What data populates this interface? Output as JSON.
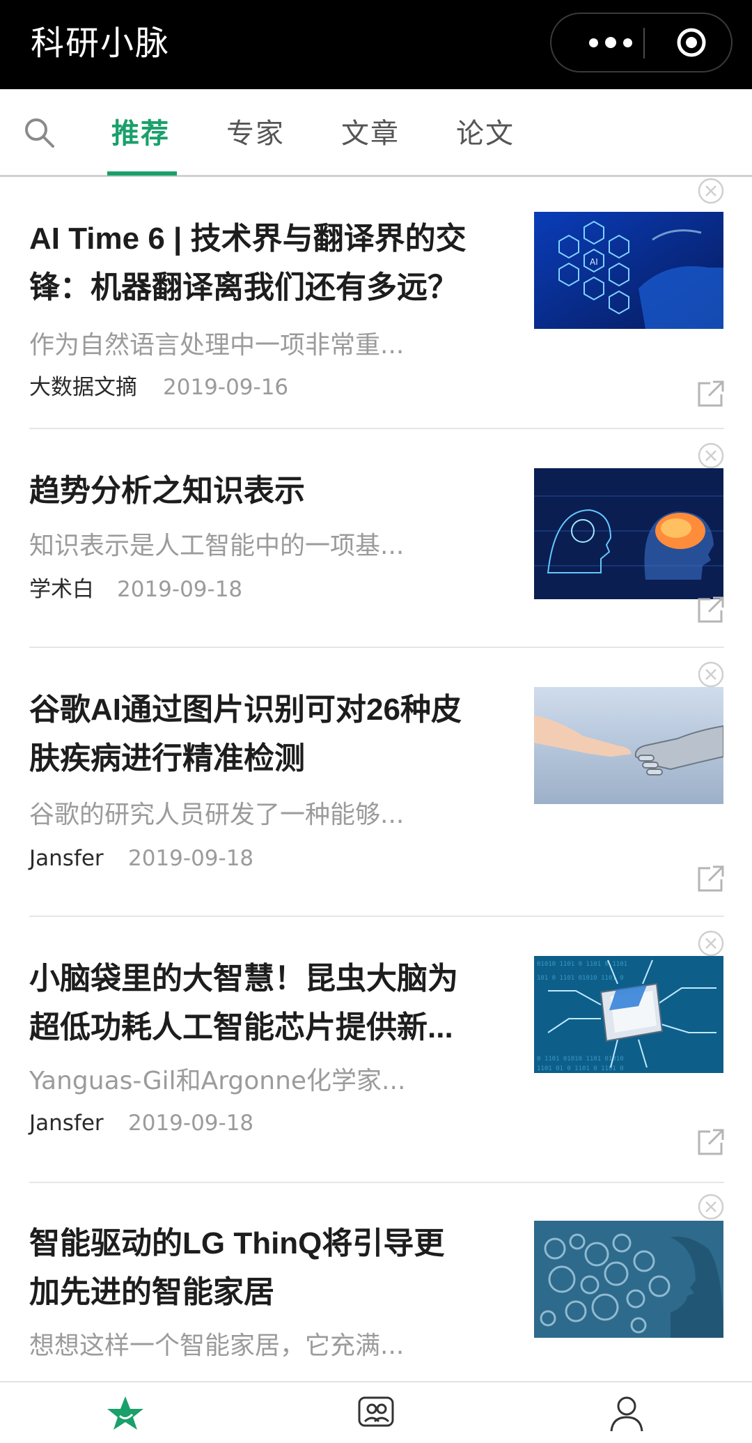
{
  "app": {
    "title": "科研小脉",
    "menu_icon": "more-dots-icon",
    "close_icon": "target-circle-icon"
  },
  "tabs": {
    "search_icon": "search-icon",
    "items": [
      {
        "label": "推荐",
        "active": true
      },
      {
        "label": "专家",
        "active": false
      },
      {
        "label": "文章",
        "active": false
      },
      {
        "label": "论文",
        "active": false
      }
    ]
  },
  "colors": {
    "accent": "#1aa06a",
    "topbar": "#000000",
    "summary_text": "#9b9b9b"
  },
  "articles": [
    {
      "title": "AI Time 6 | 技术界与翻译界的交锋：机器翻译离我们还有多远？",
      "title_lines": [
        "AI Time 6 | 技术界与翻译界的交",
        "锋：机器翻译离我们还有多远？"
      ],
      "summary": "作为自然语言处理中一项非常重...",
      "source": "大数据文摘",
      "date": "2019-09-16",
      "thumb": "ai-hexagon-tech"
    },
    {
      "title": "趋势分析之知识表示",
      "title_lines": [
        "趋势分析之知识表示"
      ],
      "summary": "知识表示是人工智能中的一项基...",
      "source": "学术白",
      "date": "2019-09-18",
      "thumb": "ai-brain-heads"
    },
    {
      "title": "谷歌AI通过图片识别可对26种皮肤疾病进行精准检测",
      "title_lines": [
        "谷歌AI通过图片识别可对26种皮",
        "肤疾病进行精准检测"
      ],
      "summary": "谷歌的研究人员研发了一种能够...",
      "source": "Jansfer",
      "date": "2019-09-18",
      "thumb": "robot-human-hands"
    },
    {
      "title": "小脑袋里的大智慧！昆虫大脑为超低功耗人工智能芯片提供新...",
      "title_lines": [
        "小脑袋里的大智慧！昆虫大脑为",
        "超低功耗人工智能芯片提供新..."
      ],
      "summary": "Yanguas-Gil和Argonne化学家...",
      "source": "Jansfer",
      "date": "2019-09-18",
      "thumb": "circuit-chip"
    },
    {
      "title": "智能驱动的LG ThinQ将引导更加先进的智能家居",
      "title_lines": [
        "智能驱动的LG ThinQ将引导更",
        "加先进的智能家居"
      ],
      "summary": "想想这样一个智能家居，它充满...",
      "source": "",
      "date": "",
      "thumb": "gear-head"
    }
  ],
  "bottom_nav": [
    {
      "icon": "star-icon",
      "active": true
    },
    {
      "icon": "group-icon",
      "active": false
    },
    {
      "icon": "person-icon",
      "active": false
    }
  ]
}
